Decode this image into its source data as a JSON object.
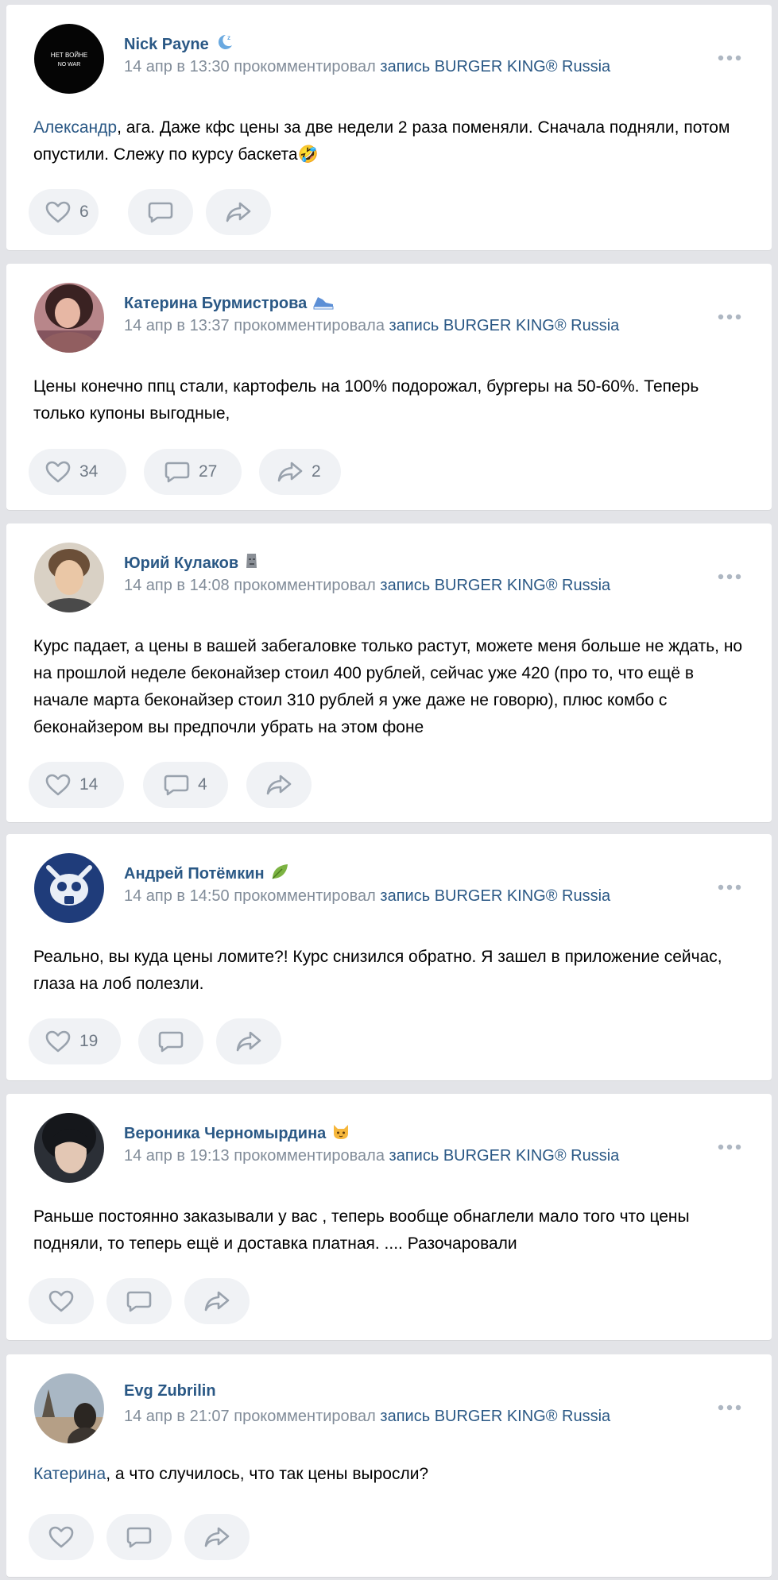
{
  "colors": {
    "background": "#e3e4e8",
    "card": "#ffffff",
    "link": "#2a5885",
    "meta": "#818c99",
    "action_pill": "#f0f2f5",
    "action_icon": "#99a2ad"
  },
  "comments": [
    {
      "author": "Nick Payne",
      "badge_icon": "sleeping-moon-emoji-icon",
      "avatar_text_line1": "НЕТ ВОЙНЕ",
      "avatar_text_line2": "NO WAR",
      "meta_date": "14 апр в 13:30",
      "meta_action": "прокомментировал",
      "meta_post_link": "запись BURGER KING® Russia",
      "mention": "Александр",
      "text": ", ага. Даже кфс цены за две недели 2 раза поменяли. Сначала подняли, потом опустили. Слежу по курсу баскета🤣",
      "likes": "6",
      "replies": "",
      "shares": ""
    },
    {
      "author": "Катерина Бурмистрова",
      "badge_icon": "sneaker-emoji-icon",
      "meta_date": "14 апр в 13:37",
      "meta_action": "прокомментировала",
      "meta_post_link": "запись BURGER KING® Russia",
      "mention": "",
      "text": "Цены конечно ппц стали, картофель на 100% подорожал, бургеры на 50-60%. Теперь только купоны выгодные,",
      "likes": "34",
      "replies": "27",
      "shares": "2"
    },
    {
      "author": "Юрий Кулаков",
      "badge_icon": "moai-emoji-icon",
      "meta_date": "14 апр в 14:08",
      "meta_action": "прокомментировал",
      "meta_post_link": "запись BURGER KING® Russia",
      "mention": "",
      "text": "Курс падает, а цены в вашей забегаловке только растут, можете меня больше не ждать, но на прошлой неделе беконайзер стоил 400 рублей, сейчас уже 420 (про то, что ещё в начале марта беконайзер стоил 310 рублей я уже даже не говорю), плюс комбо с беконайзером вы предпочли убрать на этом фоне",
      "likes": "14",
      "replies": "4",
      "shares": ""
    },
    {
      "author": "Андрей Потёмкин",
      "badge_icon": "leaf-emoji-icon",
      "meta_date": "14 апр в 14:50",
      "meta_action": "прокомментировал",
      "meta_post_link": "запись BURGER KING® Russia",
      "mention": "",
      "text": "Реально, вы куда цены ломите?! Курс снизился обратно. Я зашел в приложение сейчас, глаза на лоб полезли.",
      "likes": "19",
      "replies": "",
      "shares": ""
    },
    {
      "author": "Вероника Черномырдина",
      "badge_icon": "cat-face-emoji-icon",
      "meta_date": "14 апр в 19:13",
      "meta_action": "прокомментировала",
      "meta_post_link": "запись BURGER KING® Russia",
      "mention": "",
      "text": "Раньше постоянно заказывали у вас , теперь вообще обнаглели мало того что цены подняли, то теперь ещё и доставка платная. .... Разочаровали",
      "likes": "",
      "replies": "",
      "shares": ""
    },
    {
      "author": "Evg Zubrilin",
      "badge_icon": "",
      "meta_date": "14 апр в 21:07",
      "meta_action": "прокомментировал",
      "meta_post_link": "запись BURGER KING® Russia",
      "mention": "Катерина",
      "text": ", а что случилось, что так цены выросли?",
      "likes": "",
      "replies": "",
      "shares": ""
    }
  ]
}
